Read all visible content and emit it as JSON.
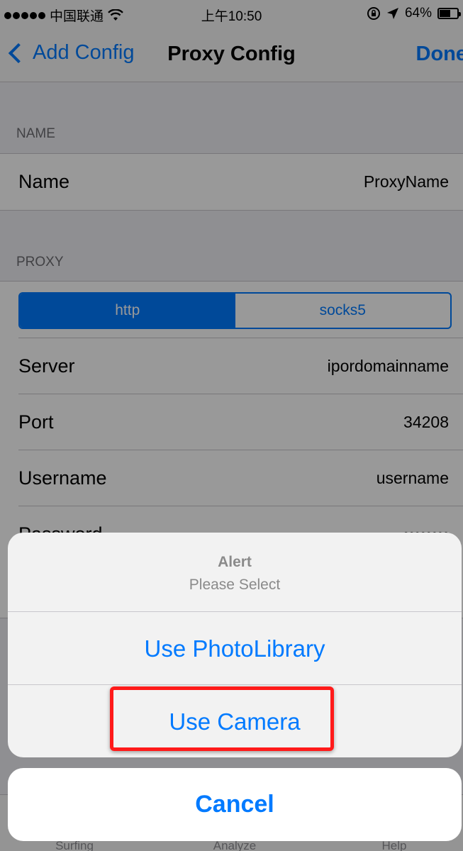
{
  "status_bar": {
    "carrier": "中国联通",
    "time": "上午10:50",
    "battery_percent": "64%",
    "battery_level": 0.64,
    "icons": [
      "signal-dots-icon",
      "wifi-icon",
      "orientation-lock-icon",
      "location-arrow-icon",
      "battery-icon"
    ]
  },
  "nav": {
    "back_label": "Add Config",
    "title": "Proxy Config",
    "done_label": "Done"
  },
  "sections": {
    "name_header": "NAME",
    "proxy_header": "PROXY"
  },
  "name_row": {
    "label": "Name",
    "value": "ProxyName"
  },
  "proxy_type": {
    "options": [
      "http",
      "socks5"
    ],
    "selected": "http"
  },
  "proxy_rows": [
    {
      "label": "Server",
      "value": "ipordomainname"
    },
    {
      "label": "Port",
      "value": "34208"
    },
    {
      "label": "Username",
      "value": "username"
    },
    {
      "label": "Password",
      "value": "••••••••"
    }
  ],
  "tab_bar": [
    "Surfing",
    "Analyze",
    "Help"
  ],
  "alert": {
    "title": "Alert",
    "message": "Please Select",
    "actions": [
      "Use PhotoLibrary",
      "Use Camera"
    ],
    "cancel": "Cancel",
    "highlighted_action": "Use Camera"
  },
  "colors": {
    "accent": "#007aff",
    "highlight": "#ff1a1a",
    "background": "#efeff4"
  }
}
